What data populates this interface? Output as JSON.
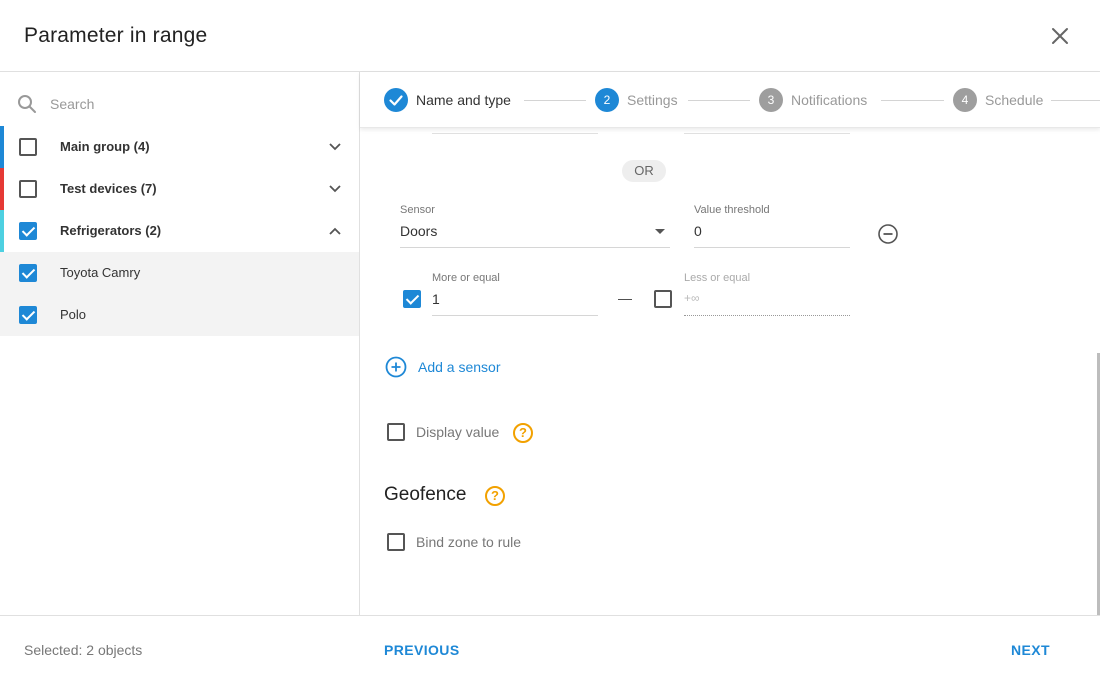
{
  "dialog": {
    "title": "Parameter in range"
  },
  "sidebar": {
    "search_placeholder": "Search",
    "groups": [
      {
        "label": "Main group (4)",
        "checked": false,
        "color": "#1e88d6",
        "expanded": false
      },
      {
        "label": "Test devices (7)",
        "checked": false,
        "color": "#e53935",
        "expanded": false
      },
      {
        "label": "Refrigerators (2)",
        "checked": true,
        "color": "#4dd0e1",
        "expanded": true
      }
    ],
    "items": [
      {
        "label": "Toyota Camry",
        "checked": true
      },
      {
        "label": "Polo",
        "checked": true
      }
    ]
  },
  "stepper": {
    "steps": [
      {
        "number": "",
        "label": "Name and type",
        "state": "done"
      },
      {
        "number": "2",
        "label": "Settings",
        "state": "active"
      },
      {
        "number": "3",
        "label": "Notifications",
        "state": "pending"
      },
      {
        "number": "4",
        "label": "Schedule",
        "state": "pending"
      }
    ]
  },
  "form": {
    "or_label": "OR",
    "sensor_label": "Sensor",
    "sensor_value": "Doors",
    "threshold_label": "Value threshold",
    "threshold_value": "0",
    "more_equal_label": "More or equal",
    "more_equal_value": "1",
    "more_equal_checked": true,
    "range_dash": "—",
    "less_equal_label": "Less or equal",
    "less_equal_placeholder": "+∞",
    "less_equal_checked": false,
    "add_sensor": "Add a sensor",
    "display_value": "Display value",
    "help_mark": "?",
    "geofence_title": "Geofence",
    "bind_zone": "Bind zone to rule"
  },
  "footer": {
    "selected_text": "Selected: 2 objects",
    "previous": "PREVIOUS",
    "next": "NEXT"
  },
  "colors": {
    "accent": "#1e88d6",
    "help": "#f2a100",
    "step_pending": "#9e9e9e"
  }
}
